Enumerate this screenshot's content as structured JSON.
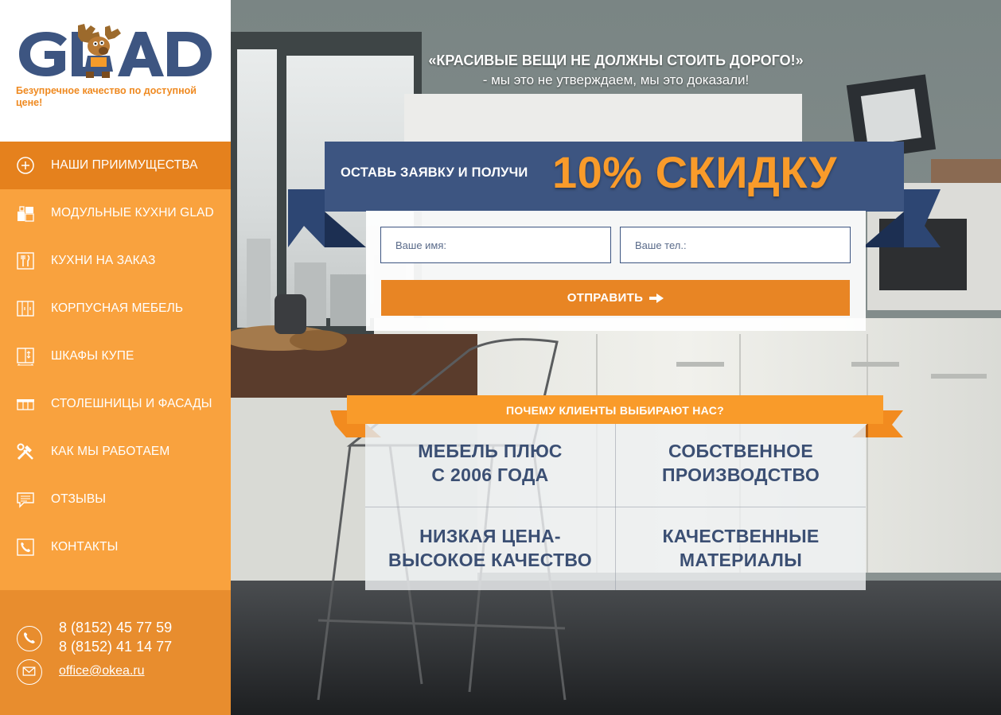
{
  "brand": {
    "logo_text": "GLAD",
    "tagline": "Безупречное качество по доступной цене!"
  },
  "nav": {
    "items": [
      {
        "label": "НАШИ ПРИИМУЩЕСТВА",
        "icon": "plus-circle-icon",
        "active": true
      },
      {
        "label": "МОДУЛЬНЫЕ КУХНИ GLAD",
        "icon": "modules-icon",
        "active": false
      },
      {
        "label": "КУХНИ НА ЗАКАЗ",
        "icon": "cutlery-icon",
        "active": false
      },
      {
        "label": "КОРПУСНАЯ МЕБЕЛЬ",
        "icon": "cabinet-icon",
        "active": false
      },
      {
        "label": "ШКАФЫ КУПЕ",
        "icon": "wardrobe-icon",
        "active": false
      },
      {
        "label": "СТОЛЕШНИЦЫ И ФАСАДЫ",
        "icon": "countertop-icon",
        "active": false
      },
      {
        "label": "КАК МЫ РАБОТАЕМ",
        "icon": "tools-icon",
        "active": false
      },
      {
        "label": "ОТЗЫВЫ",
        "icon": "chat-icon",
        "active": false
      },
      {
        "label": "КОНТАКТЫ",
        "icon": "phone-book-icon",
        "active": false
      }
    ]
  },
  "contacts": {
    "phone1": "8 (8152) 45 77 59",
    "phone2": "8 (8152) 41 14 77",
    "email": "office@okea.ru"
  },
  "hero": {
    "slogan": "«КРАСИВЫЕ ВЕЩИ НЕ ДОЛЖНЫ СТОИТЬ ДОРОГО!»",
    "subslogan": "- мы это не утверждаем, мы это доказали!"
  },
  "offer": {
    "lead": "ОСТАВЬ ЗАЯВКУ И ПОЛУЧИ",
    "highlight": "10% СКИДКУ",
    "name_placeholder": "Ваше имя:",
    "phone_placeholder": "Ваше тел.:",
    "submit_label": "ОТПРАВИТЬ"
  },
  "why": {
    "title": "ПОЧЕМУ КЛИЕНТЫ ВЫБИРАЮТ НАС?",
    "cells": [
      {
        "line1": "МЕБЕЛЬ ПЛЮС",
        "line2": "С 2006 ГОДА"
      },
      {
        "line1": "СОБСТВЕННОЕ",
        "line2": "ПРОИЗВОДСТВО"
      },
      {
        "line1": "НИЗКАЯ ЦЕНА-",
        "line2": "ВЫСОКОЕ КАЧЕСТВО"
      },
      {
        "line1": "КАЧЕСТВЕННЫЕ",
        "line2": "МАТЕРИАЛЫ"
      }
    ]
  },
  "colors": {
    "orange": "#f9a23e",
    "orange_dark": "#e5811d",
    "navy": "#3d5581",
    "navy_text": "#3b4f73",
    "white": "#ffffff"
  }
}
